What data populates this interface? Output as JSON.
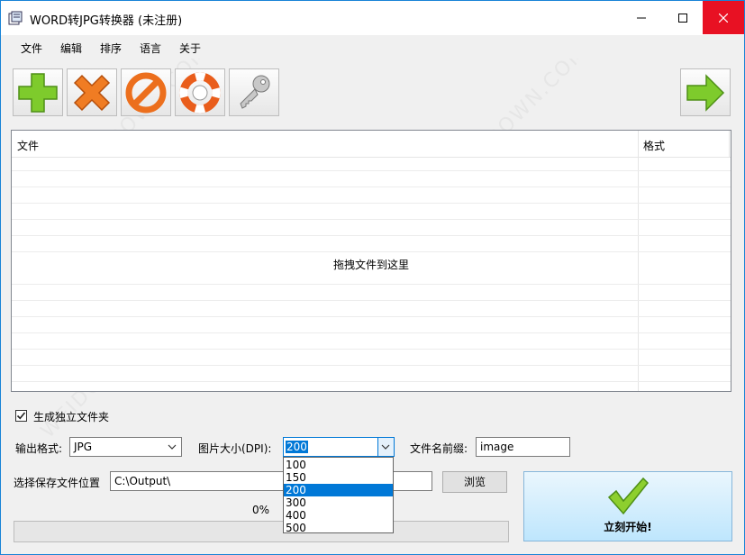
{
  "window": {
    "title": "WORD转JPG转换器 (未注册)",
    "colors": {
      "accent": "#1883d7",
      "close": "#e81123",
      "selection": "#0078d7"
    }
  },
  "menu": [
    "文件",
    "编辑",
    "排序",
    "语言",
    "关于"
  ],
  "toolbar": {
    "buttons": [
      {
        "name": "add-file",
        "icon": "plus-icon"
      },
      {
        "name": "remove-file",
        "icon": "x-icon"
      },
      {
        "name": "clear-all",
        "icon": "no-entry-icon"
      },
      {
        "name": "help",
        "icon": "lifebuoy-icon"
      },
      {
        "name": "register",
        "icon": "key-icon"
      },
      {
        "name": "next",
        "icon": "arrow-right-icon"
      }
    ]
  },
  "file_list": {
    "columns": [
      "文件",
      "格式"
    ],
    "rows": [],
    "empty_hint": "拖拽文件到这里"
  },
  "options": {
    "separate_folder": {
      "label": "生成独立文件夹",
      "checked": true
    },
    "output_format": {
      "label": "输出格式:",
      "value": "JPG"
    },
    "dpi": {
      "label": "图片大小(DPI):",
      "value": "200",
      "options": [
        "100",
        "150",
        "200",
        "300",
        "400",
        "500"
      ],
      "dropdown_open": true
    },
    "prefix": {
      "label": "文件名前缀:",
      "value": "image"
    },
    "save_location": {
      "label": "选择保存文件位置",
      "value": "C:\\Output\\"
    },
    "browse_label": "浏览"
  },
  "progress": {
    "percent_text": "0%",
    "value": 0
  },
  "start": {
    "label": "立刻开始!",
    "icon": "checkmark-icon"
  },
  "watermark": "WEIDOWN.COM"
}
